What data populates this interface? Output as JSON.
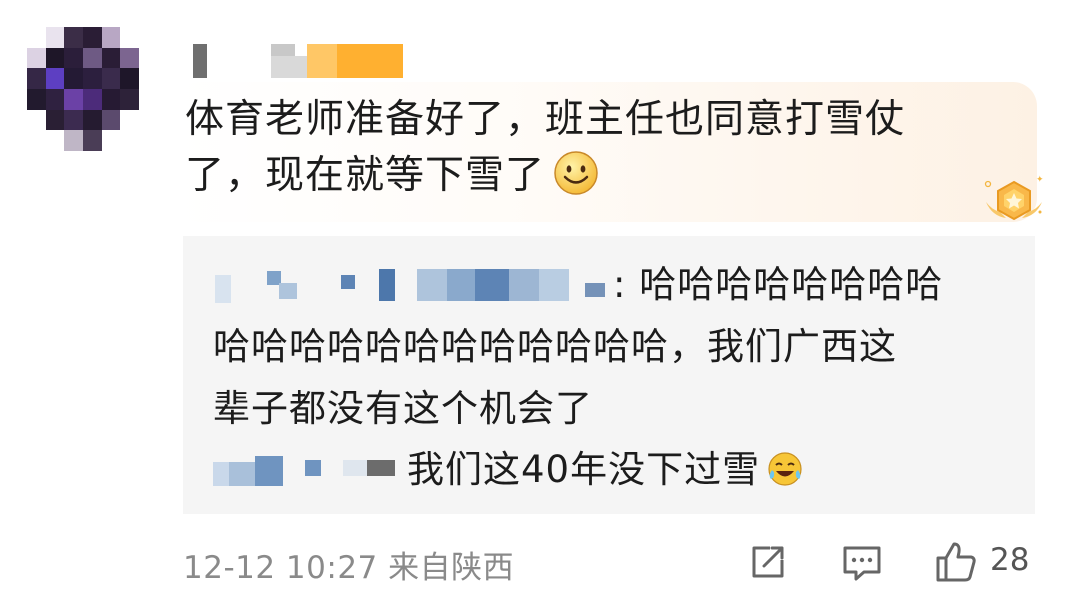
{
  "comment": {
    "line1": "体育老师准备好了，班主任也同意打雪仗",
    "line2": "了，现在就等下雪了"
  },
  "reply": {
    "line1_tail": ": 哈哈哈哈哈哈哈哈",
    "line2": "哈哈哈哈哈哈哈哈哈哈哈哈，我们广西这",
    "line3": "辈子都没有这个机会了"
  },
  "sub_reply": {
    "text": "我们这40年没下过雪"
  },
  "footer": {
    "time": "12-12 10:27 来自陕西",
    "like_count": "28"
  },
  "icons": [
    "pixelated-avatar",
    "smile-emoji-icon",
    "medal-badge-icon",
    "laugh-cry-emoji-icon",
    "share-icon",
    "comment-icon",
    "thumbs-up-icon"
  ],
  "colors": {
    "text": "#1c1c1c",
    "secondary_text": "#8a8a8a",
    "reply_bg": "#f5f5f5",
    "accent_orange": "#ffb030",
    "mask_blue": "#7fa2c9"
  }
}
